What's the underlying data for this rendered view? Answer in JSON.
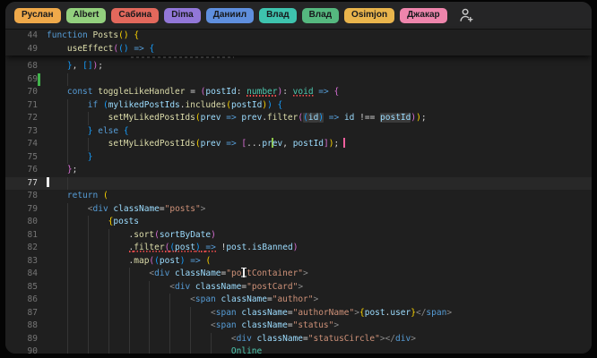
{
  "header": {
    "users": [
      {
        "name": "Руслан",
        "color": "#efa94a"
      },
      {
        "name": "Albert",
        "color": "#93d07e"
      },
      {
        "name": "Сабина",
        "color": "#e2685c"
      },
      {
        "name": "Dima",
        "color": "#9277d8"
      },
      {
        "name": "Даниил",
        "color": "#5f8fde"
      },
      {
        "name": "Влад",
        "color": "#3ec3ae"
      },
      {
        "name": "Влад",
        "color": "#55b87f"
      },
      {
        "name": "Osimjon",
        "color": "#e9b44c"
      },
      {
        "name": "Джакар",
        "color": "#ee85ac"
      }
    ],
    "invite_icon": "person-add-icon"
  },
  "editor": {
    "colors": {
      "background": "#1f1f1f",
      "header_background": "#252526",
      "keyword": "#569cd6",
      "function": "#dcdcaa",
      "variable": "#9cdcfe",
      "string": "#ce9178",
      "type": "#4ec9b0",
      "bracket_gold": "#ffd700",
      "bracket_purple": "#da70d6",
      "bracket_blue": "#179fff",
      "error_squiggle": "#f14c4c",
      "git_added": "#42b34c",
      "remote_caret_green": "#8bc34a",
      "remote_caret_pink": "#f0609e"
    },
    "sticky_lines": [
      {
        "n": 44,
        "ind": 0,
        "seg": [
          [
            "function",
            "kw"
          ],
          [
            " ",
            "pln"
          ],
          [
            "Posts",
            "fn"
          ],
          [
            "(",
            "b1"
          ],
          [
            ")",
            "b1"
          ],
          [
            " ",
            "pln"
          ],
          [
            "{",
            "b1"
          ]
        ]
      },
      {
        "n": 49,
        "ind": 4,
        "seg": [
          [
            "    ",
            "pln"
          ],
          [
            "useEffect",
            "fn"
          ],
          [
            "(",
            "b2"
          ],
          [
            "(",
            "b3"
          ],
          [
            ")",
            "b3"
          ],
          [
            " ",
            "pln"
          ],
          [
            "=>",
            "arrow"
          ],
          [
            " ",
            "pln"
          ],
          [
            "{",
            "b3"
          ]
        ]
      }
    ],
    "partial_line": {
      "note": "clipped bottom sliver of a scrolled code line, illegible"
    },
    "lines": [
      {
        "n": 68,
        "ind": 4,
        "seg": [
          [
            "    ",
            "pln"
          ],
          [
            "}",
            "b3"
          ],
          [
            ", ",
            "pln"
          ],
          [
            "[",
            "b3"
          ],
          [
            "]",
            "b3"
          ],
          [
            ")",
            "b2"
          ],
          [
            ";",
            "pln"
          ]
        ]
      },
      {
        "n": 69,
        "ind": 8,
        "git": "added",
        "seg": []
      },
      {
        "n": 70,
        "ind": 4,
        "seg": [
          [
            "    ",
            "pln"
          ],
          [
            "const",
            "kw"
          ],
          [
            " ",
            "pln"
          ],
          [
            "toggleLikeHandler",
            "fn"
          ],
          [
            " = ",
            "pln"
          ],
          [
            "(",
            "b2"
          ],
          [
            "postId",
            "var"
          ],
          [
            ": ",
            "pln"
          ],
          [
            "number",
            "type sq"
          ],
          [
            ")",
            "b2"
          ],
          [
            ": ",
            "pln"
          ],
          [
            "void",
            "type sq"
          ],
          [
            " ",
            "pln"
          ],
          [
            "=>",
            "arrow"
          ],
          [
            " ",
            "pln"
          ],
          [
            "{",
            "b2"
          ]
        ]
      },
      {
        "n": 71,
        "ind": 8,
        "seg": [
          [
            "        ",
            "pln"
          ],
          [
            "if",
            "kw"
          ],
          [
            " ",
            "pln"
          ],
          [
            "(",
            "b3"
          ],
          [
            "mylikedPostIds",
            "var"
          ],
          [
            ".",
            "pln"
          ],
          [
            "includes",
            "fn"
          ],
          [
            "(",
            "b1"
          ],
          [
            "postId",
            "var"
          ],
          [
            ")",
            "b1"
          ],
          [
            ")",
            "b3"
          ],
          [
            " ",
            "pln"
          ],
          [
            "{",
            "b3"
          ]
        ]
      },
      {
        "n": 72,
        "ind": 12,
        "seg": [
          [
            "            ",
            "pln"
          ],
          [
            "setMyLikedPostIds",
            "fn"
          ],
          [
            "(",
            "b1"
          ],
          [
            "prev",
            "var"
          ],
          [
            " ",
            "pln"
          ],
          [
            "=>",
            "arrow"
          ],
          [
            " ",
            "pln"
          ],
          [
            "prev",
            "var"
          ],
          [
            ".",
            "pln"
          ],
          [
            "filter",
            "fn"
          ],
          [
            "(",
            "b2"
          ],
          [
            "(",
            "b3 hl"
          ],
          [
            "id",
            "var hl"
          ],
          [
            ")",
            "b3 hl"
          ],
          [
            " ",
            "pln"
          ],
          [
            "=>",
            "arrow"
          ],
          [
            " ",
            "pln"
          ],
          [
            "id",
            "var"
          ],
          [
            " ",
            "pln"
          ],
          [
            "!==",
            "pln"
          ],
          [
            " ",
            "pln"
          ],
          [
            "postId",
            "var hl"
          ],
          [
            ")",
            "b2"
          ],
          [
            ")",
            "b1"
          ],
          [
            ";",
            "pln"
          ]
        ]
      },
      {
        "n": 73,
        "ind": 8,
        "seg": [
          [
            "        ",
            "pln"
          ],
          [
            "}",
            "b3"
          ],
          [
            " ",
            "pln"
          ],
          [
            "else",
            "kw"
          ],
          [
            " ",
            "pln"
          ],
          [
            "{",
            "b3"
          ]
        ]
      },
      {
        "n": 74,
        "ind": 12,
        "seg": [
          [
            "            ",
            "pln"
          ],
          [
            "setMyLikedPostIds",
            "fn"
          ],
          [
            "(",
            "b1"
          ],
          [
            "prev",
            "var"
          ],
          [
            " ",
            "pln"
          ],
          [
            "=>",
            "arrow"
          ],
          [
            " ",
            "pln"
          ],
          [
            "[",
            "b2"
          ],
          [
            "...",
            "pln"
          ],
          [
            "pr",
            "var"
          ],
          [
            "",
            "caret green"
          ],
          [
            "ev",
            "var"
          ],
          [
            ", ",
            "pln"
          ],
          [
            "postId",
            "var"
          ],
          [
            "]",
            "b2"
          ],
          [
            ")",
            "b1"
          ],
          [
            "; ",
            "pln"
          ],
          [
            "",
            "caret pink"
          ]
        ]
      },
      {
        "n": 75,
        "ind": 8,
        "seg": [
          [
            "        ",
            "pln"
          ],
          [
            "}",
            "b3"
          ]
        ]
      },
      {
        "n": 76,
        "ind": 4,
        "seg": [
          [
            "    ",
            "pln"
          ],
          [
            "}",
            "b2"
          ],
          [
            ";",
            "pln"
          ]
        ]
      },
      {
        "n": 77,
        "ind": 8,
        "active": true,
        "seg": [
          [
            "",
            "caret white"
          ]
        ]
      },
      {
        "n": 78,
        "ind": 4,
        "seg": [
          [
            "    ",
            "pln"
          ],
          [
            "return",
            "kw"
          ],
          [
            " ",
            "pln"
          ],
          [
            "(",
            "b1"
          ]
        ]
      },
      {
        "n": 79,
        "ind": 8,
        "seg": [
          [
            "        ",
            "pln"
          ],
          [
            "<",
            "ang"
          ],
          [
            "div",
            "tag"
          ],
          [
            " ",
            "pln"
          ],
          [
            "className",
            "attr"
          ],
          [
            "=",
            "pln"
          ],
          [
            "\"posts\"",
            "str"
          ],
          [
            ">",
            "ang"
          ]
        ]
      },
      {
        "n": 80,
        "ind": 12,
        "seg": [
          [
            "            ",
            "pln"
          ],
          [
            "{",
            "b1"
          ],
          [
            "posts",
            "var"
          ]
        ]
      },
      {
        "n": 81,
        "ind": 16,
        "seg": [
          [
            "                ",
            "pln"
          ],
          [
            ".",
            "pln"
          ],
          [
            "sort",
            "fn"
          ],
          [
            "(",
            "b2"
          ],
          [
            "sortByDate",
            "var"
          ],
          [
            ")",
            "b2"
          ]
        ]
      },
      {
        "n": 82,
        "ind": 16,
        "seg": [
          [
            "                ",
            "pln"
          ],
          [
            ".",
            "pln sq"
          ],
          [
            "filter",
            "fn sq"
          ],
          [
            "(",
            "b2 sq"
          ],
          [
            "(",
            "b3 sq"
          ],
          [
            "post",
            "var sq"
          ],
          [
            ")",
            "b3 sq"
          ],
          [
            " ",
            "pln sq"
          ],
          [
            "=>",
            "arrow sq"
          ],
          [
            " ",
            "pln"
          ],
          [
            "!",
            "pln"
          ],
          [
            "post",
            "var"
          ],
          [
            ".",
            "pln"
          ],
          [
            "isBanned",
            "var"
          ],
          [
            ")",
            "b2"
          ]
        ]
      },
      {
        "n": 83,
        "ind": 16,
        "seg": [
          [
            "                ",
            "pln"
          ],
          [
            ".",
            "pln"
          ],
          [
            "map",
            "fn"
          ],
          [
            "(",
            "b2"
          ],
          [
            "(",
            "b3"
          ],
          [
            "post",
            "var"
          ],
          [
            ")",
            "b3"
          ],
          [
            " ",
            "pln"
          ],
          [
            "=>",
            "arrow"
          ],
          [
            " ",
            "pln"
          ],
          [
            "(",
            "b1"
          ]
        ]
      },
      {
        "n": 84,
        "ind": 20,
        "seg": [
          [
            "                    ",
            "pln"
          ],
          [
            "<",
            "ang"
          ],
          [
            "div",
            "tag"
          ],
          [
            " ",
            "pln"
          ],
          [
            "className",
            "attr"
          ],
          [
            "=",
            "pln"
          ],
          [
            "\"po",
            "str"
          ],
          [
            "",
            "ibeam"
          ],
          [
            "tContainer\"",
            "str"
          ],
          [
            ">",
            "ang"
          ]
        ]
      },
      {
        "n": 85,
        "ind": 24,
        "seg": [
          [
            "                        ",
            "pln"
          ],
          [
            "<",
            "ang"
          ],
          [
            "div",
            "tag"
          ],
          [
            " ",
            "pln"
          ],
          [
            "className",
            "attr"
          ],
          [
            "=",
            "pln"
          ],
          [
            "\"postCard\"",
            "str"
          ],
          [
            ">",
            "ang"
          ]
        ]
      },
      {
        "n": 86,
        "ind": 28,
        "seg": [
          [
            "                            ",
            "pln"
          ],
          [
            "<",
            "ang"
          ],
          [
            "span",
            "tag"
          ],
          [
            " ",
            "pln"
          ],
          [
            "className",
            "attr"
          ],
          [
            "=",
            "pln"
          ],
          [
            "\"author\"",
            "str"
          ],
          [
            ">",
            "ang"
          ]
        ]
      },
      {
        "n": 87,
        "ind": 32,
        "seg": [
          [
            "                                ",
            "pln"
          ],
          [
            "<",
            "ang"
          ],
          [
            "span",
            "tag"
          ],
          [
            " ",
            "pln"
          ],
          [
            "className",
            "attr"
          ],
          [
            "=",
            "pln"
          ],
          [
            "\"authorName\"",
            "str"
          ],
          [
            ">",
            "ang"
          ],
          [
            "{",
            "b1"
          ],
          [
            "post",
            "var"
          ],
          [
            ".",
            "pln"
          ],
          [
            "user",
            "var"
          ],
          [
            "}",
            "b1"
          ],
          [
            "</",
            "ang"
          ],
          [
            "span",
            "tag"
          ],
          [
            ">",
            "ang"
          ]
        ]
      },
      {
        "n": 88,
        "ind": 32,
        "seg": [
          [
            "                                ",
            "pln"
          ],
          [
            "<",
            "ang"
          ],
          [
            "span",
            "tag"
          ],
          [
            " ",
            "pln"
          ],
          [
            "className",
            "attr"
          ],
          [
            "=",
            "pln"
          ],
          [
            "\"status\"",
            "str"
          ],
          [
            ">",
            "ang"
          ]
        ]
      },
      {
        "n": 89,
        "ind": 36,
        "seg": [
          [
            "                                    ",
            "pln"
          ],
          [
            "<",
            "ang"
          ],
          [
            "div",
            "tag"
          ],
          [
            " ",
            "pln"
          ],
          [
            "className",
            "attr"
          ],
          [
            "=",
            "pln"
          ],
          [
            "\"statusCircle\"",
            "str"
          ],
          [
            ">",
            "ang"
          ],
          [
            "</",
            "ang"
          ],
          [
            "div",
            "tag"
          ],
          [
            ">",
            "ang"
          ]
        ]
      },
      {
        "n": 90,
        "ind": 36,
        "seg": [
          [
            "                                    ",
            "pln"
          ],
          [
            "Online",
            "jsxtext"
          ]
        ]
      }
    ]
  }
}
